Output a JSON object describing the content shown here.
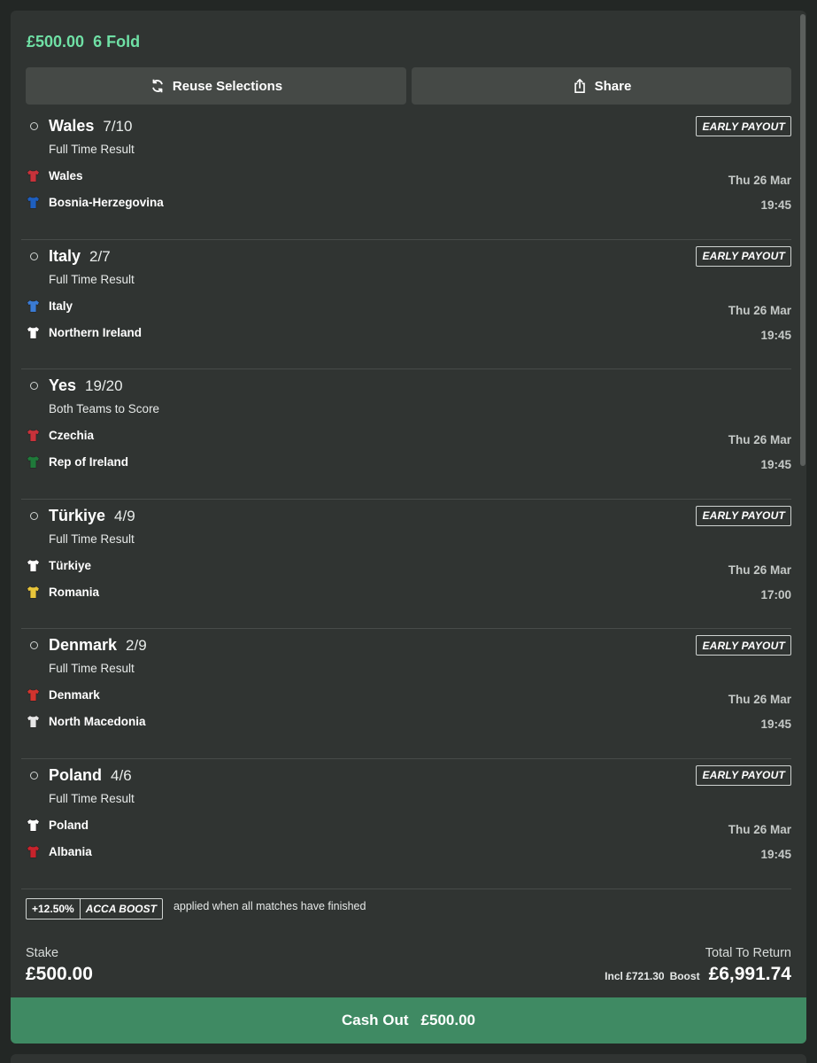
{
  "bet": {
    "stake_display": "£500.00",
    "type": "6 Fold"
  },
  "actions": {
    "reuse_label": "Reuse Selections",
    "share_label": "Share"
  },
  "legs": [
    {
      "selection": "Wales",
      "odds": "7/10",
      "market": "Full Time Result",
      "badge": "EARLY PAYOUT",
      "home": "Wales",
      "away": "Bosnia-Herzegovina",
      "date": "Thu 26 Mar",
      "time": "19:45",
      "home_shirt": "#c8323a",
      "away_shirt": "#1e5fbf"
    },
    {
      "selection": "Italy",
      "odds": "2/7",
      "market": "Full Time Result",
      "badge": "EARLY PAYOUT",
      "home": "Italy",
      "away": "Northern Ireland",
      "date": "Thu 26 Mar",
      "time": "19:45",
      "home_shirt": "#3a7bd5",
      "away_shirt": "#ffffff"
    },
    {
      "selection": "Yes",
      "odds": "19/20",
      "market": "Both Teams to Score",
      "badge": "",
      "home": "Czechia",
      "away": "Rep of Ireland",
      "date": "Thu 26 Mar",
      "time": "19:45",
      "home_shirt": "#c8323a",
      "away_shirt": "#1f7a3a"
    },
    {
      "selection": "Türkiye",
      "odds": "4/9",
      "market": "Full Time Result",
      "badge": "EARLY PAYOUT",
      "home": "Türkiye",
      "away": "Romania",
      "date": "Thu 26 Mar",
      "time": "17:00",
      "home_shirt": "#ffffff",
      "away_shirt": "#e8c53a"
    },
    {
      "selection": "Denmark",
      "odds": "2/9",
      "market": "Full Time Result",
      "badge": "EARLY PAYOUT",
      "home": "Denmark",
      "away": "North Macedonia",
      "date": "Thu 26 Mar",
      "time": "19:45",
      "home_shirt": "#d2342e",
      "away_shirt": "#e6e6e6"
    },
    {
      "selection": "Poland",
      "odds": "4/6",
      "market": "Full Time Result",
      "badge": "EARLY PAYOUT",
      "home": "Poland",
      "away": "Albania",
      "date": "Thu 26 Mar",
      "time": "19:45",
      "home_shirt": "#ffffff",
      "away_shirt": "#c8232c"
    }
  ],
  "boost": {
    "percent": "+12.50%",
    "label": "ACCA BOOST",
    "note": "applied when all matches have finished"
  },
  "summary": {
    "stake_label": "Stake",
    "stake_value": "£500.00",
    "return_label": "Total To Return",
    "incl_amount": "Incl £721.30",
    "incl_label": "Boost",
    "return_value": "£6,991.74"
  },
  "cashout": {
    "label": "Cash Out",
    "amount": "£500.00"
  },
  "colors": {
    "accent": "#6fe0a5",
    "cashout_bg": "#3f8a63",
    "card_bg": "#303432"
  }
}
